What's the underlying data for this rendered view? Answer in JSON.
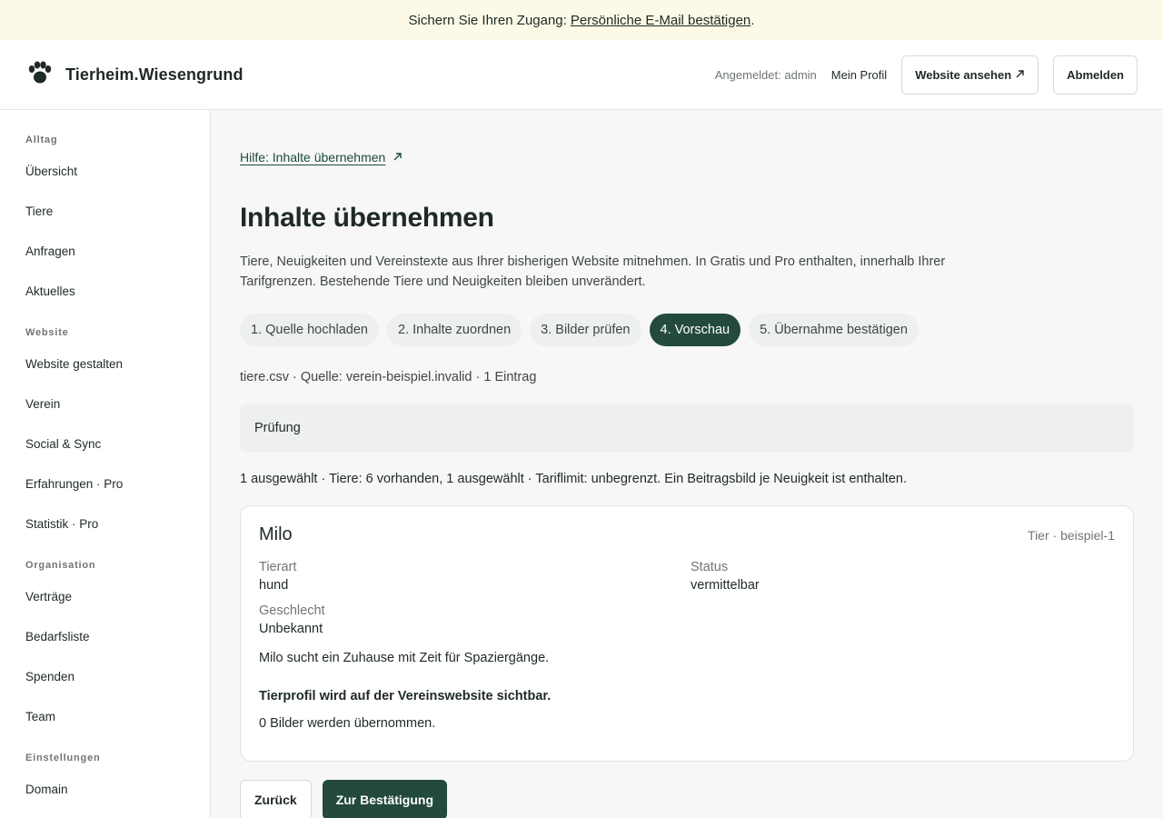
{
  "banner": {
    "text": "Sichern Sie Ihren Zugang:",
    "link": "Persönliche E-Mail bestätigen",
    "suffix": "."
  },
  "header": {
    "brand": "Tierheim.Wiesengrund",
    "logged_in": "Angemeldet: admin",
    "profile": "Mein Profil",
    "view_site": "Website ansehen",
    "logout": "Abmelden"
  },
  "sidebar": {
    "sections": [
      {
        "title": "Alltag",
        "items": [
          "Übersicht",
          "Tiere",
          "Anfragen",
          "Aktuelles"
        ]
      },
      {
        "title": "Website",
        "items": [
          "Website gestalten",
          "Verein",
          "Social & Sync",
          "Erfahrungen · Pro",
          "Statistik · Pro"
        ]
      },
      {
        "title": "Organisation",
        "items": [
          "Verträge",
          "Bedarfsliste",
          "Spenden",
          "Team"
        ]
      },
      {
        "title": "Einstellungen",
        "items": [
          "Domain"
        ]
      }
    ]
  },
  "main": {
    "help_link": "Hilfe: Inhalte übernehmen",
    "title": "Inhalte übernehmen",
    "description": "Tiere, Neuigkeiten und Vereinstexte aus Ihrer bisherigen Website mitnehmen. In Gratis und Pro enthalten, innerhalb Ihrer Tarifgrenzen. Bestehende Tiere und Neuigkeiten bleiben unverändert.",
    "steps": [
      "1. Quelle hochladen",
      "2. Inhalte zuordnen",
      "3. Bilder prüfen",
      "4. Vorschau",
      "5. Übernahme bestätigen"
    ],
    "active_step": 3,
    "meta": "tiere.csv · Quelle: verein-beispiel.invalid · 1 Eintrag",
    "check_label": "Prüfung",
    "summary": "1 ausgewählt · Tiere: 6 vorhanden, 1 ausgewählt · Tariflimit: unbegrenzt. Ein Beitragsbild je Neuigkeit ist enthalten.",
    "card": {
      "name": "Milo",
      "tag": "Tier · beispiel-1",
      "species_label": "Tierart",
      "species": "hund",
      "status_label": "Status",
      "status": "vermittelbar",
      "gender_label": "Geschlecht",
      "gender": "Unbekannt",
      "text": "Milo sucht ein Zuhause mit Zeit für Spaziergänge.",
      "visibility": "Tierprofil wird auf der Vereinswebsite sichtbar.",
      "images": "0 Bilder werden übernommen."
    },
    "back": "Zurück",
    "next": "Zur Bestätigung"
  },
  "colors": {
    "accent": "#234a3b",
    "banner_bg": "#fdf9e7",
    "main_bg": "#f6f7f6"
  }
}
